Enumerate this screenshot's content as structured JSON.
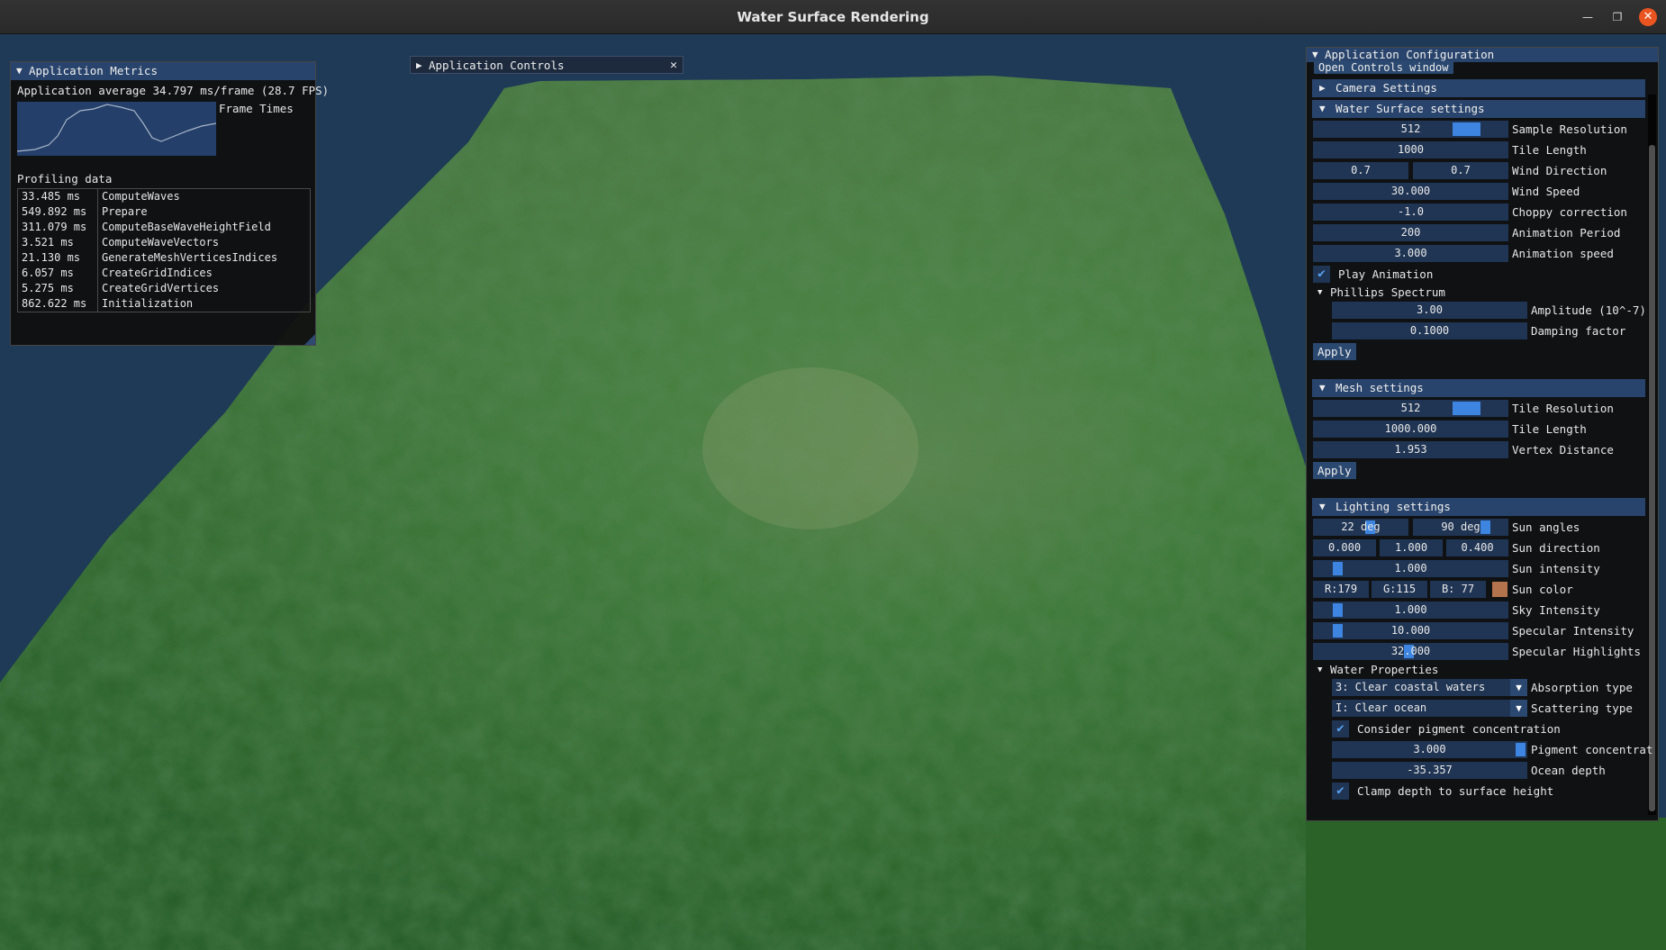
{
  "window": {
    "title": "Water Surface Rendering"
  },
  "metrics": {
    "title": "Application Metrics",
    "average_text": "Application average 34.797 ms/frame (28.7 FPS)",
    "plot_label": "Frame Times",
    "profiling_label": "Profiling data",
    "profiling": [
      {
        "ms": "33.485 ms",
        "name": "ComputeWaves"
      },
      {
        "ms": "549.892 ms",
        "name": "Prepare"
      },
      {
        "ms": "311.079 ms",
        "name": "ComputeBaseWaveHeightField"
      },
      {
        "ms": "3.521 ms",
        "name": "ComputeWaveVectors"
      },
      {
        "ms": "21.130 ms",
        "name": "GenerateMeshVerticesIndices"
      },
      {
        "ms": "6.057 ms",
        "name": "CreateGridIndices"
      },
      {
        "ms": "5.275 ms",
        "name": "CreateGridVertices"
      },
      {
        "ms": "862.622 ms",
        "name": "Initialization"
      }
    ]
  },
  "controls": {
    "title": "Application Controls",
    "close": "✕"
  },
  "config": {
    "title": "Application Configuration",
    "open_controls": "Open Controls window",
    "camera": {
      "header": "Camera Settings"
    },
    "water": {
      "header": "Water Surface settings",
      "sample_resolution": {
        "value": "512",
        "label": "Sample Resolution",
        "fraction": 0.8
      },
      "tile_length": {
        "value": "1000",
        "label": "Tile Length"
      },
      "wind_direction": {
        "x": "0.7",
        "y": "0.7",
        "label": "Wind Direction"
      },
      "wind_speed": {
        "value": "30.000",
        "label": "Wind Speed"
      },
      "choppy": {
        "value": "-1.0",
        "label": "Choppy correction"
      },
      "anim_period": {
        "value": "200",
        "label": "Animation Period"
      },
      "anim_speed": {
        "value": "3.000",
        "label": "Animation speed"
      },
      "play": {
        "label": "Play Animation",
        "checked": true
      },
      "phillips": {
        "header": "Phillips Spectrum",
        "amplitude": {
          "value": "3.00",
          "label": "Amplitude (10^-7)"
        },
        "damping": {
          "value": "0.1000",
          "label": "Damping factor"
        }
      },
      "apply": "Apply"
    },
    "mesh": {
      "header": "Mesh settings",
      "tile_resolution": {
        "value": "512",
        "label": "Tile Resolution",
        "fraction": 0.8
      },
      "tile_length": {
        "value": "1000.000",
        "label": "Tile Length"
      },
      "vertex_distance": {
        "value": "1.953",
        "label": "Vertex Distance"
      },
      "apply": "Apply"
    },
    "lighting": {
      "header": "Lighting settings",
      "sun_angles": {
        "a": "22 deg",
        "b": "90 deg",
        "label": "Sun angles"
      },
      "sun_direction": {
        "x": "0.000",
        "y": "1.000",
        "z": "0.400",
        "label": "Sun direction"
      },
      "sun_intensity": {
        "value": "1.000",
        "label": "Sun intensity"
      },
      "sun_color": {
        "r": "R:179",
        "g": "G:115",
        "b": "B: 77",
        "label": "Sun color",
        "swatch": "#b3734d"
      },
      "sky_intensity": {
        "value": "1.000",
        "label": "Sky Intensity"
      },
      "specular_intensity": {
        "value": "10.000",
        "label": "Specular Intensity"
      },
      "specular_highlights": {
        "value": "32.000",
        "label": "Specular Highlights"
      },
      "water_props": {
        "header": "Water Properties",
        "absorption": {
          "value": "3: Clear coastal waters",
          "label": "Absorption type"
        },
        "scattering": {
          "value": "I: Clear ocean",
          "label": "Scattering type"
        },
        "pigment_check": {
          "label": "Consider pigment concentration",
          "checked": true
        },
        "pigment": {
          "value": "3.000",
          "label": "Pigment concentrat"
        },
        "ocean_depth": {
          "value": "-35.357",
          "label": "Ocean depth"
        },
        "clamp": {
          "label": "Clamp depth to surface height",
          "checked": true
        }
      }
    }
  },
  "colors": {
    "background": "#1e3a56",
    "terrain": "#2f6a2c",
    "header": "#29446c",
    "frame": "#203554",
    "grab": "#3d85e0"
  }
}
